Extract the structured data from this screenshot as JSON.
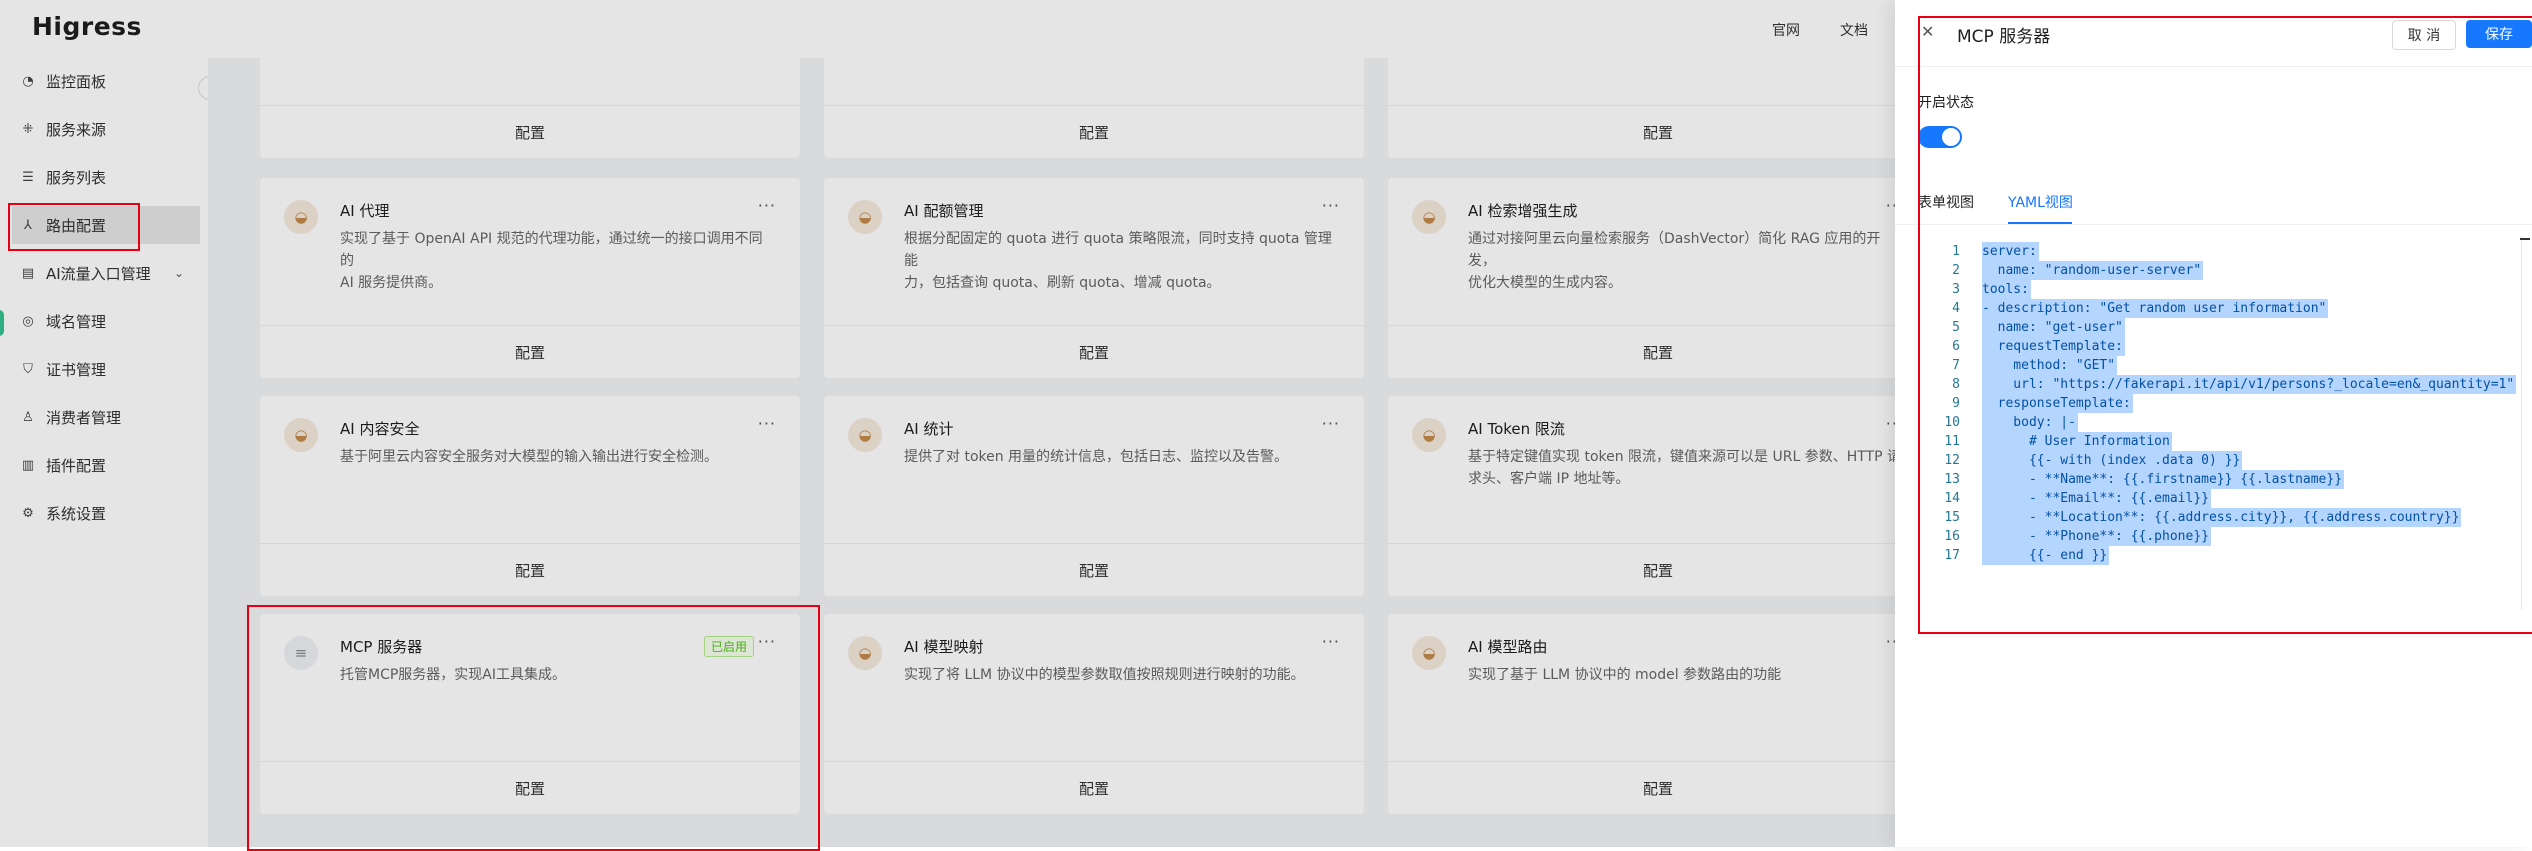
{
  "app": {
    "logo": "Higress",
    "top_links": [
      "官网",
      "文档"
    ]
  },
  "sidebar": {
    "items": [
      {
        "label": "监控面板",
        "icon": "dashboard-icon"
      },
      {
        "label": "服务来源",
        "icon": "service-source-icon"
      },
      {
        "label": "服务列表",
        "icon": "list-icon"
      },
      {
        "label": "路由配置",
        "icon": "route-icon"
      },
      {
        "label": "AI流量入口管理",
        "icon": "ai-gateway-icon"
      },
      {
        "label": "域名管理",
        "icon": "globe-icon"
      },
      {
        "label": "证书管理",
        "icon": "certificate-icon"
      },
      {
        "label": "消费者管理",
        "icon": "user-icon"
      },
      {
        "label": "插件配置",
        "icon": "plugin-icon"
      },
      {
        "label": "系统设置",
        "icon": "settings-icon"
      }
    ]
  },
  "cards": [
    {
      "title": "",
      "desc": "",
      "button": "配置"
    },
    {
      "title": "",
      "desc": "",
      "button": "配置"
    },
    {
      "title": "",
      "desc": "",
      "button": "配置"
    },
    {
      "title": "AI 代理",
      "desc": "实现了基于 OpenAI API 规范的代理功能，通过统一的接口调用不同的\nAI 服务提供商。",
      "button": "配置"
    },
    {
      "title": "AI 配额管理",
      "desc": "根据分配固定的 quota 进行 quota 策略限流，同时支持 quota 管理能\n力，包括查询 quota、刷新 quota、增减 quota。",
      "button": "配置"
    },
    {
      "title": "AI 检索增强生成",
      "desc": "通过对接阿里云向量检索服务（DashVector）简化 RAG 应用的开发，\n优化大模型的生成内容。",
      "button": "配置"
    },
    {
      "title": "AI 内容安全",
      "desc": "基于阿里云内容安全服务对大模型的输入输出进行安全检测。",
      "button": "配置"
    },
    {
      "title": "AI 统计",
      "desc": "提供了对 token 用量的统计信息，包括日志、监控以及告警。",
      "button": "配置"
    },
    {
      "title": "AI Token 限流",
      "desc": "基于特定键值实现 token 限流，键值来源可以是 URL 参数、HTTP 请\n求头、客户端 IP 地址等。",
      "button": "配置"
    },
    {
      "title": "MCP 服务器",
      "desc": "托管MCP服务器，实现AI工具集成。",
      "button": "配置",
      "badge": "已启用"
    },
    {
      "title": "AI 模型映射",
      "desc": "实现了将 LLM 协议中的模型参数取值按照规则进行映射的功能。",
      "button": "配置"
    },
    {
      "title": "AI 模型路由",
      "desc": "实现了基于 LLM 协议中的 model 参数路由的功能",
      "button": "配置"
    }
  ],
  "drawer": {
    "title": "MCP 服务器",
    "cancel_label": "取 消",
    "save_label": "保存",
    "status_label": "开启状态",
    "enabled": true,
    "tabs": [
      {
        "label": "表单视图",
        "active": false
      },
      {
        "label": "YAML视图",
        "active": true
      }
    ],
    "yaml_lines": [
      "server:",
      "  name: \"random-user-server\"",
      "tools:",
      "- description: \"Get random user information\"",
      "  name: \"get-user\"",
      "  requestTemplate:",
      "    method: \"GET\"",
      "    url: \"https://fakerapi.it/api/v1/persons?_locale=en&_quantity=1\"",
      "  responseTemplate:",
      "    body: |-",
      "      # User Information",
      "      {{- with (index .data 0) }}",
      "      - **Name**: {{.firstname}} {{.lastname}}",
      "      - **Email**: {{.email}}",
      "      - **Location**: {{.address.city}}, {{.address.country}}",
      "      - **Phone**: {{.phone}}",
      "      {{- end }}"
    ]
  }
}
